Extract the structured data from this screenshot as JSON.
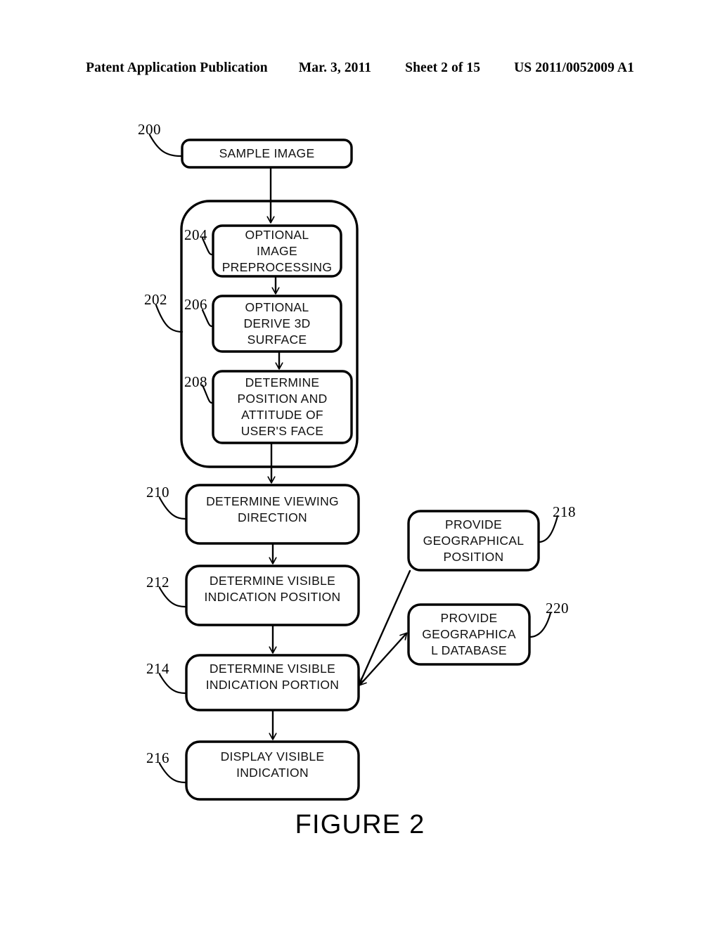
{
  "header": {
    "left": "Patent Application Publication",
    "date": "Mar. 3, 2011",
    "sheet": "Sheet 2 of 15",
    "publication_number": "US 2011/0052009 A1"
  },
  "figure": {
    "caption": "FIGURE 2",
    "line_color": "#000000",
    "fill_color": "#ffffff"
  },
  "nodes": {
    "n200": {
      "ref": "200",
      "text": "SAMPLE IMAGE"
    },
    "n202": {
      "ref": "202",
      "text": ""
    },
    "n204": {
      "ref": "204",
      "text": "OPTIONAL\nIMAGE\nPREPROCESSING"
    },
    "n206": {
      "ref": "206",
      "text": "OPTIONAL\nDERIVE 3D\nSURFACE"
    },
    "n208": {
      "ref": "208",
      "text": "DETERMINE\nPOSITION AND\nATTITUDE OF\nUSER'S FACE"
    },
    "n210": {
      "ref": "210",
      "text": "DETERMINE VIEWING\nDIRECTION"
    },
    "n212": {
      "ref": "212",
      "text": "DETERMINE VISIBLE\nINDICATION POSITION"
    },
    "n214": {
      "ref": "214",
      "text": "DETERMINE VISIBLE\nINDICATION PORTION"
    },
    "n216": {
      "ref": "216",
      "text": "DISPLAY VISIBLE\nINDICATION"
    },
    "n218": {
      "ref": "218",
      "text": "PROVIDE\nGEOGRAPHICAL\nPOSITION"
    },
    "n220": {
      "ref": "220",
      "text": "PROVIDE\nGEOGRAPHICA\nL DATABASE"
    }
  }
}
